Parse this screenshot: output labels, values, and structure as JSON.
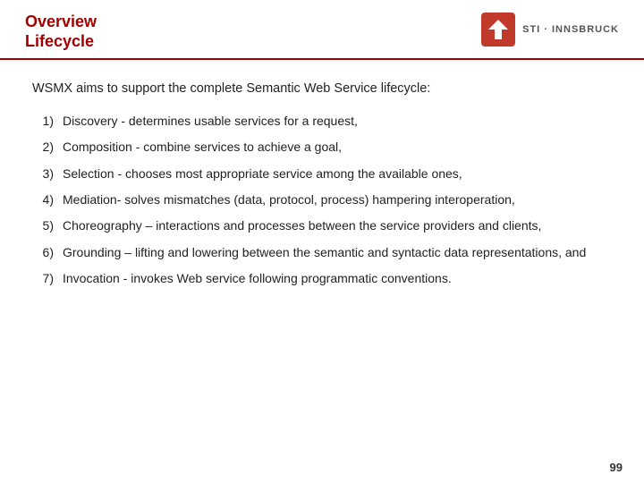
{
  "header": {
    "title_line1": "Overview",
    "title_line2": "Lifecycle",
    "logo_text": "STI · INNSBRUCK"
  },
  "content": {
    "intro": "WSMX aims to support the complete Semantic Web Service lifecycle:",
    "items": [
      {
        "num": "1)",
        "text": "Discovery - determines usable services for a request,"
      },
      {
        "num": "2)",
        "text": "Composition - combine services to achieve a goal,"
      },
      {
        "num": "3)",
        "text": "Selection - chooses most appropriate service among the available ones,"
      },
      {
        "num": "4)",
        "text": "Mediation- solves mismatches (data, protocol, process) hampering interoperation,"
      },
      {
        "num": "5)",
        "text": "Choreography – interactions and processes between the service providers and clients,"
      },
      {
        "num": "6)",
        "text": "Grounding – lifting and lowering between the semantic and syntactic data representations, and"
      },
      {
        "num": "7)",
        "text": "Invocation - invokes Web service following programmatic conventions."
      }
    ]
  },
  "footer": {
    "page_number": "99"
  }
}
